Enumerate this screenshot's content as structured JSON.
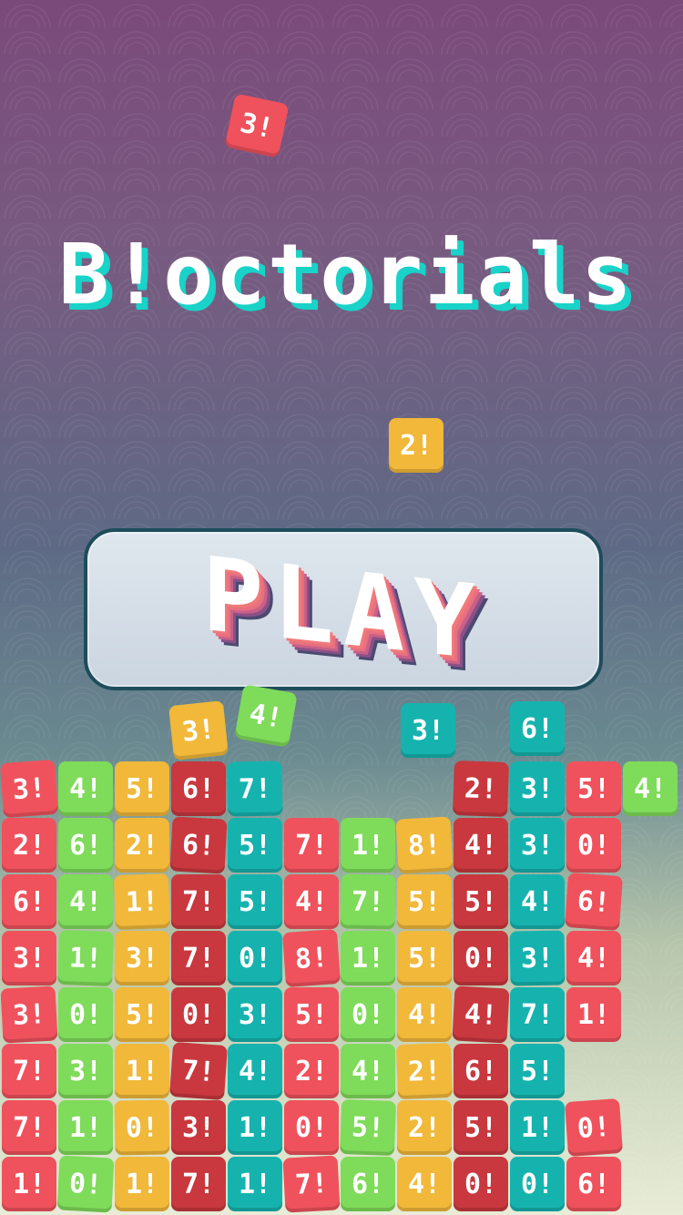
{
  "title": "B!octorials",
  "play_label": "PLAY",
  "colors": {
    "red": "#ef525c",
    "yellow": "#f1b83a",
    "teal": "#16b3ae",
    "green": "#7fdb5a",
    "accent_cyan": "#19d2c8"
  },
  "falling_tiles": [
    {
      "label": "3!",
      "color": "red"
    },
    {
      "label": "2!",
      "color": "yellow"
    },
    {
      "label": "3!",
      "color": "yellow"
    },
    {
      "label": "4!",
      "color": "green"
    },
    {
      "label": "3!",
      "color": "teal"
    },
    {
      "label": "6!",
      "color": "teal"
    }
  ],
  "grid_rows": [
    [
      "3!",
      "4!",
      "5!",
      "6!",
      "7!",
      "",
      "",
      "",
      "2!",
      "3!",
      "5!",
      "4!"
    ],
    [
      "2!",
      "6!",
      "2!",
      "6!",
      "5!",
      "7!",
      "1!",
      "8!",
      "4!",
      "3!",
      "0!",
      ""
    ],
    [
      "6!",
      "4!",
      "1!",
      "7!",
      "5!",
      "4!",
      "7!",
      "5!",
      "5!",
      "4!",
      "6!",
      ""
    ],
    [
      "3!",
      "1!",
      "3!",
      "7!",
      "0!",
      "8!",
      "1!",
      "5!",
      "0!",
      "3!",
      "4!",
      ""
    ],
    [
      "3!",
      "0!",
      "5!",
      "0!",
      "3!",
      "5!",
      "0!",
      "4!",
      "4!",
      "7!",
      "1!",
      ""
    ],
    [
      "7!",
      "3!",
      "1!",
      "7!",
      "4!",
      "2!",
      "4!",
      "2!",
      "6!",
      "5!",
      "",
      ""
    ],
    [
      "7!",
      "1!",
      "0!",
      "3!",
      "1!",
      "0!",
      "5!",
      "2!",
      "5!",
      "1!",
      "0!",
      ""
    ],
    [
      "1!",
      "0!",
      "1!",
      "7!",
      "1!",
      "7!",
      "6!",
      "4!",
      "0!",
      "0!",
      "6!",
      ""
    ]
  ]
}
